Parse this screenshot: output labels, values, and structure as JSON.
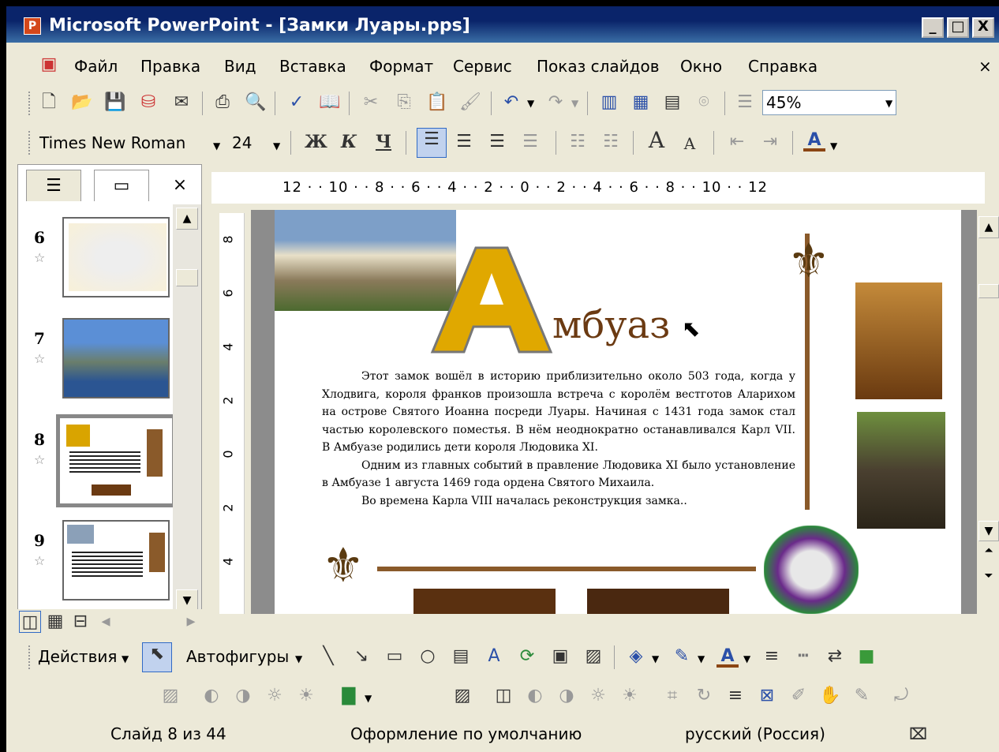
{
  "title_bar": {
    "app_icon": "powerpoint-icon",
    "title": "Microsoft PowerPoint - [Замки Луары.pps]",
    "minimize": "_",
    "maximize": "□",
    "close": "X"
  },
  "menu": {
    "items": [
      "Файл",
      "Правка",
      "Вид",
      "Вставка",
      "Формат",
      "Сервис",
      "Показ слайдов",
      "Окно",
      "Справка"
    ],
    "close_doc": "×"
  },
  "standard_toolbar": {
    "zoom": "45%"
  },
  "format_toolbar": {
    "font": "Times New Roman",
    "size": "24",
    "bold": "Ж",
    "italic": "К",
    "underline": "Ч",
    "grow_font": "A",
    "shrink_font": "A",
    "font_color": "A"
  },
  "outline_pane": {
    "close": "×",
    "slides": [
      {
        "number": "6"
      },
      {
        "number": "7"
      },
      {
        "number": "8"
      },
      {
        "number": "9"
      }
    ]
  },
  "ruler": {
    "horizontal": "12 · · 10 · · 8 · · 6 · · 4 · · 2 · · 0 · · 2 · · 4 · · 6 · · 8 · · 10 · · 12",
    "vertical": [
      "8",
      "6",
      "4",
      "2",
      "0",
      "2",
      "4"
    ]
  },
  "slide": {
    "drop_cap": "А",
    "title_rest": "мбуаз",
    "paragraphs": [
      "Этот замок вошёл в историю приблизительно около 503 года, когда у Хлодвига, короля франков произошла встреча с королём вестготов Аларихом на острове Святого Иоанна посреди Луары. Начиная с 1431 года замок стал частью королевского поместья. В нём неоднократно останавливался Карл VII. В Амбуазе родились дети короля Людовика XI.",
      "Одним из главных событий в правление Людовика XI было установление в Амбуазе 1 августа 1469 года ордена Святого Михаила.",
      "Во времена Карла VIII началась реконструкция замка.."
    ]
  },
  "drawing_toolbar": {
    "actions": "Действия",
    "autoshapes": "Автофигуры"
  },
  "status_bar": {
    "slide": "Слайд 8 из 44",
    "design": "Оформление по умолчанию",
    "language": "русский (Россия)"
  },
  "colors": {
    "title_bar": "#0a246a",
    "chrome": "#ece9d8",
    "title_brown": "#6b3a12",
    "gold": "#e0a800"
  }
}
